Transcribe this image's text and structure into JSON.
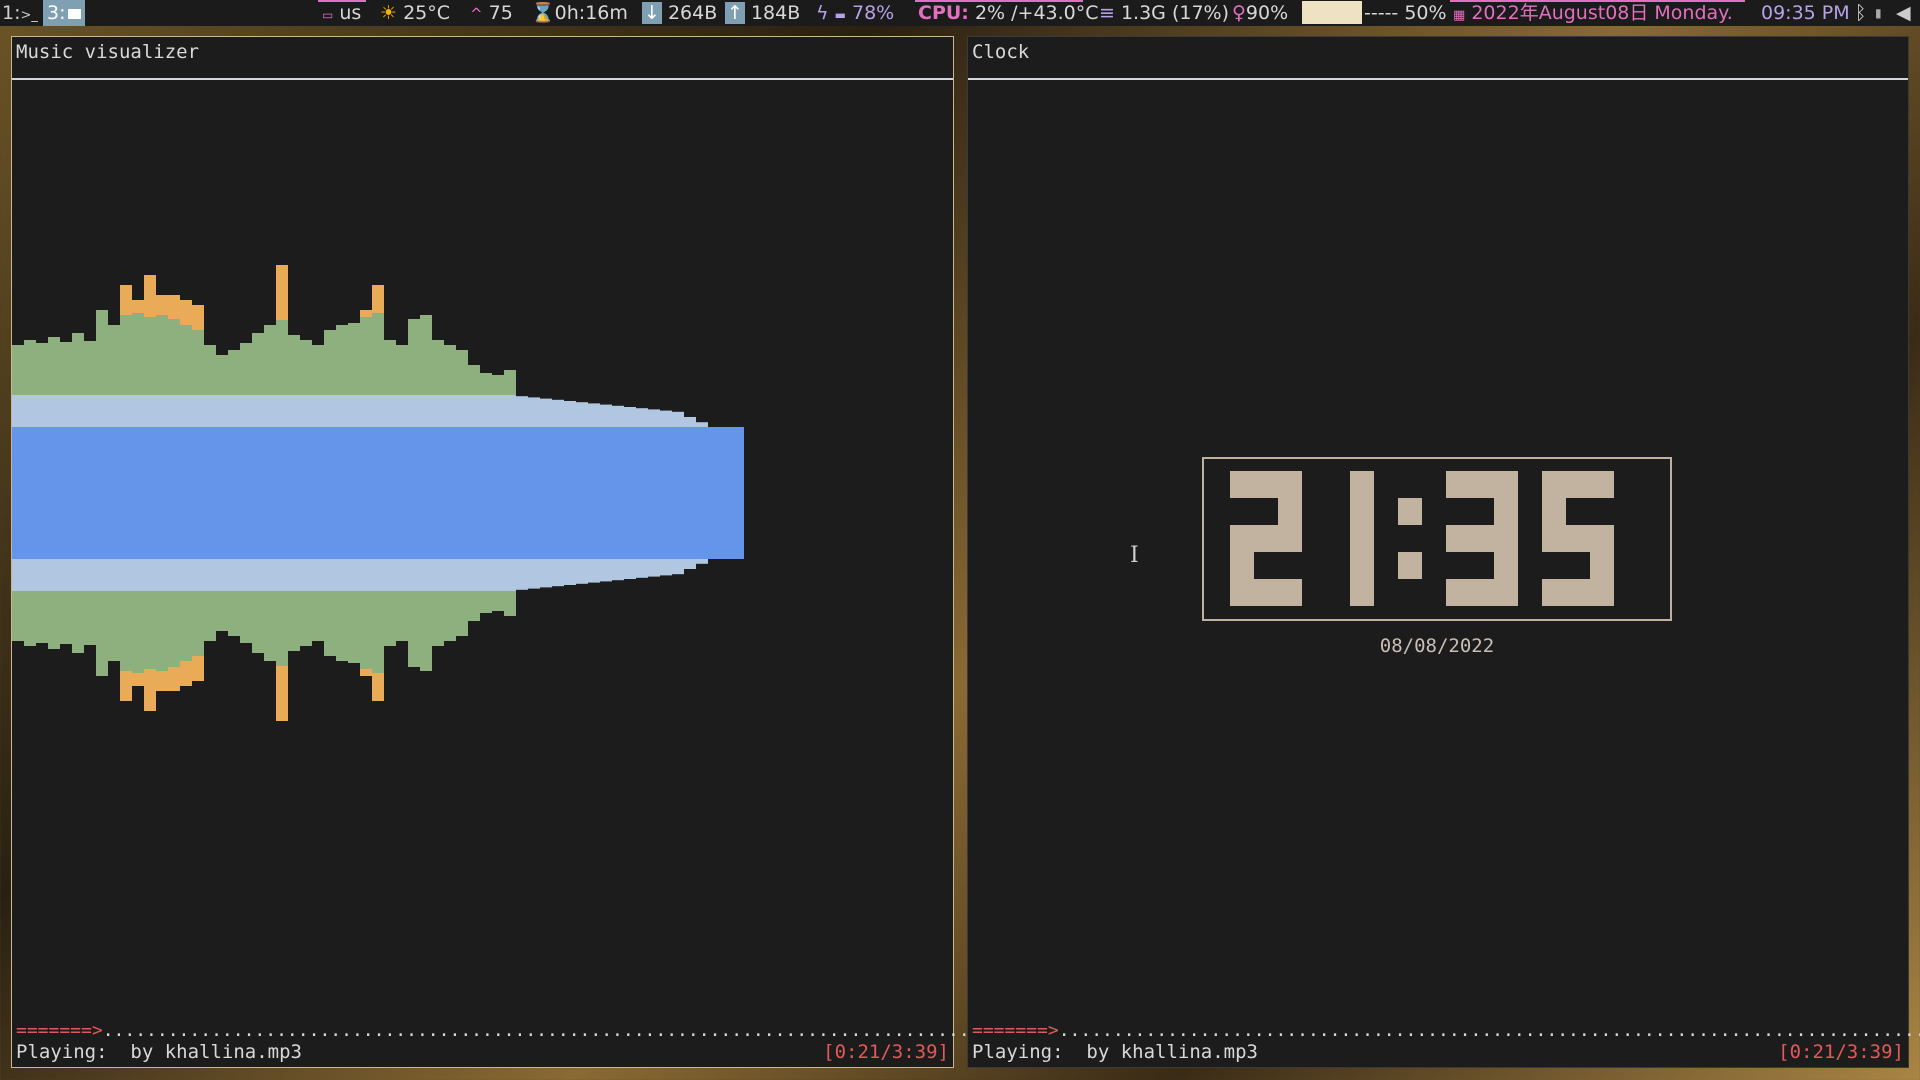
{
  "statusbar": {
    "workspace_1": "1:",
    "workspace_1_icon": "terminal-icon",
    "workspace_3": "3:",
    "workspace_3_icon": "folder-icon",
    "keyboard_layout": "us",
    "weather": "25°C",
    "updates": "75",
    "uptime": "0h:16m",
    "net_down": "264B",
    "net_up": "184B",
    "battery": "78%",
    "cpu_label": "CPU:",
    "cpu": "2% /+43.0°C",
    "memory": "1.3G (17%)",
    "brightness": "90%",
    "volume_bar": "-----",
    "volume": "50%",
    "date": "2022年August08日 Monday.",
    "time": "09:35 PM",
    "colors": {
      "bar_bg": "#1b1b1b",
      "accent_pink": "#e36fbf",
      "accent_lavender": "#b6a2e8"
    }
  },
  "left_pane": {
    "title": "Music visualizer",
    "progress_arrow": "=======>",
    "progress_dots": ".......................................................................................",
    "playing_label": "Playing:",
    "track": "by khallina.mp3",
    "elapsed": "[0:21/3:39]",
    "progress": 0.096,
    "visualizer": {
      "colors": {
        "outer": "#e9ab57",
        "mid": "#8db07e",
        "inner": "#b1c6e1",
        "core": "#6595ea"
      },
      "bars_top_orange_peak": [
        0,
        0,
        0,
        0,
        0,
        0,
        0,
        0,
        0,
        0,
        0,
        0,
        0,
        0,
        0,
        0,
        0,
        0,
        0,
        0
      ]
    }
  },
  "right_pane": {
    "title": "Clock",
    "clock_time": "21:35",
    "clock_date": "08/08/2022",
    "progress_arrow": "=======>",
    "progress_dots": ".......................................................................................",
    "playing_label": "Playing:",
    "track": "by khallina.mp3",
    "elapsed": "[0:21/3:39]",
    "clock_color": "#c2b2a0"
  }
}
